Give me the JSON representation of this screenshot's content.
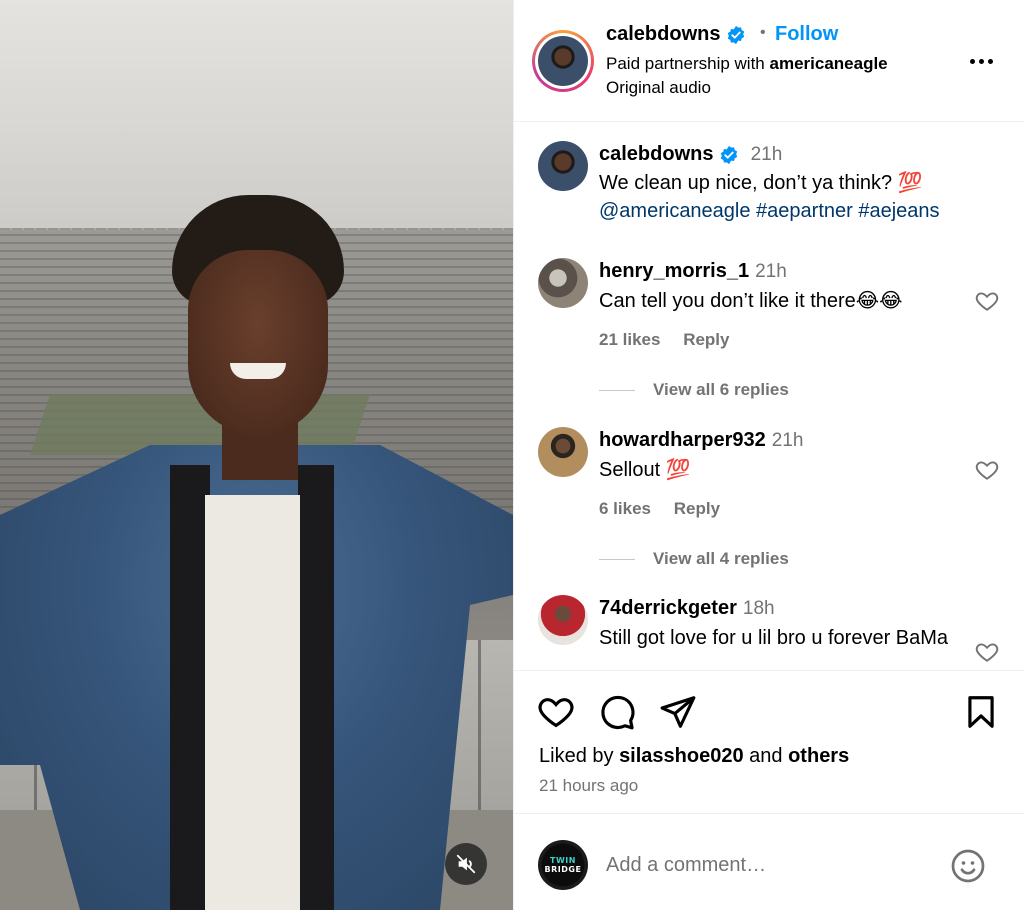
{
  "post": {
    "author": "calebdowns",
    "follow_label": "Follow",
    "separator": "•",
    "partnership_prefix": "Paid partnership with",
    "partner": "americaneagle",
    "audio": "Original audio"
  },
  "caption": {
    "username": "calebdowns",
    "time": "21h",
    "text": "We clean up nice, don’t ya think? 💯",
    "tags": "@americaneagle #aepartner #aejeans"
  },
  "comments": [
    {
      "username": "henry_morris_1",
      "time": "21h",
      "text": "Can tell you don’t like it there😂😂",
      "likes": "21 likes",
      "reply_label": "Reply",
      "view_replies": "View all 6 replies"
    },
    {
      "username": "howardharper932",
      "time": "21h",
      "text": "Sellout 💯",
      "likes": "6 likes",
      "reply_label": "Reply",
      "view_replies": "View all 4 replies"
    },
    {
      "username": "74derrickgeter",
      "time": "18h",
      "text": "Still got love for u lil bro u forever BaMa"
    }
  ],
  "engagement": {
    "liked_by_prefix": "Liked by",
    "liked_by_user": "silasshoe020",
    "liked_by_and": "and",
    "liked_by_others": "others",
    "posted": "21 hours ago"
  },
  "composer": {
    "placeholder": "Add a comment…",
    "avatar_text_top": "TWIN",
    "avatar_text_bottom": "BRIDGE"
  },
  "colors": {
    "link_blue": "#0095f6",
    "tag_navy": "#00376b",
    "secondary_text": "#737373",
    "verified_blue": "#0095f6"
  },
  "icons": {
    "verified": "verified-badge-icon",
    "more": "more-options-icon",
    "like": "heart-icon",
    "comment": "speech-bubble-icon",
    "share": "paper-plane-icon",
    "save": "bookmark-icon",
    "emoji": "smiley-icon",
    "mute": "muted-speaker-icon"
  }
}
